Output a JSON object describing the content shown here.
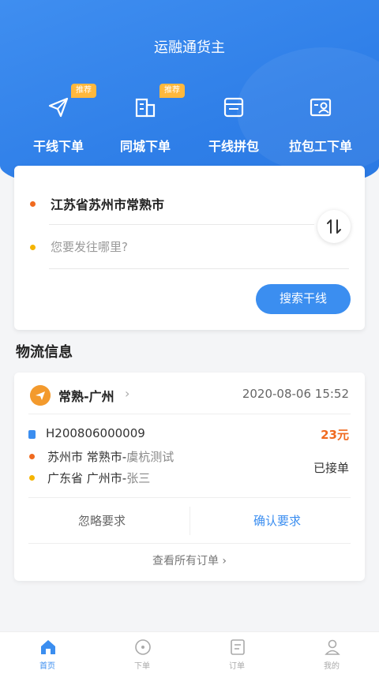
{
  "header": {
    "title": "运融通货主"
  },
  "quick_nav": [
    {
      "label": "干线下单",
      "icon": "send-arrow-icon",
      "badge": "推荐"
    },
    {
      "label": "同城下单",
      "icon": "building-icon",
      "badge": "推荐"
    },
    {
      "label": "干线拼包",
      "icon": "package-icon",
      "badge": ""
    },
    {
      "label": "拉包工下单",
      "icon": "id-card-icon",
      "badge": ""
    }
  ],
  "search": {
    "from": "江苏省苏州市常熟市",
    "to_placeholder": "您要发往哪里?",
    "swap_icon": "swap-icon",
    "button": "搜索干线"
  },
  "logistics": {
    "section_title": "物流信息",
    "order": {
      "route": "常熟-广州",
      "time": "2020-08-06 15:52",
      "order_no": "H200806000009",
      "price": "23元",
      "origin_main": "苏州市 常熟市-",
      "origin_detail": "虞杭测试",
      "dest_main": "广东省 广州市-",
      "dest_detail": "张三",
      "status": "已接单",
      "ignore_label": "忽略要求",
      "confirm_label": "确认要求"
    },
    "view_all": "查看所有订单 ›"
  },
  "tabbar": [
    {
      "label": "首页",
      "icon": "home-icon",
      "active": true
    },
    {
      "label": "下单",
      "icon": "order-circle-icon",
      "active": false
    },
    {
      "label": "订单",
      "icon": "list-icon",
      "active": false
    },
    {
      "label": "我的",
      "icon": "user-icon",
      "active": false
    }
  ],
  "colors": {
    "primary": "#3b8ef0",
    "accent_orange": "#f06a1f",
    "badge": "#ffb83d"
  }
}
